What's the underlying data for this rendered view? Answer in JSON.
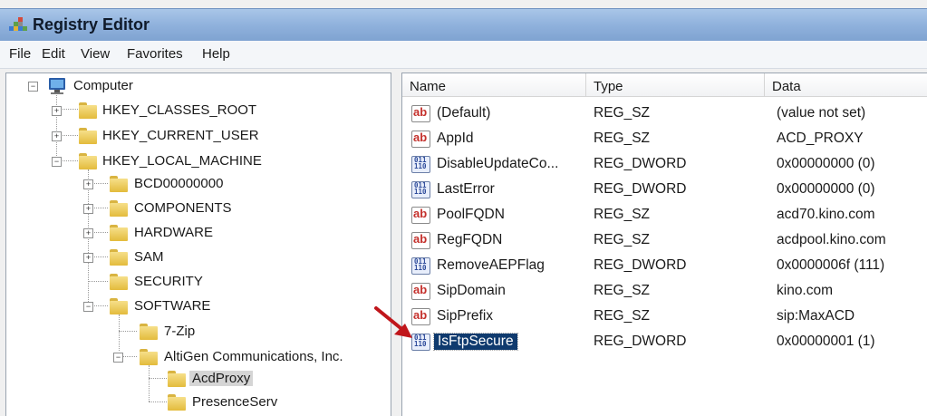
{
  "window": {
    "title": "Registry Editor"
  },
  "menu": [
    "File",
    "Edit",
    "View",
    "Favorites",
    "Help"
  ],
  "tree": {
    "root": "Computer",
    "hives": [
      "HKEY_CLASSES_ROOT",
      "HKEY_CURRENT_USER",
      "HKEY_LOCAL_MACHINE"
    ],
    "hklm_children": [
      "BCD00000000",
      "COMPONENTS",
      "HARDWARE",
      "SAM",
      "SECURITY",
      "SOFTWARE"
    ],
    "software_children": [
      "7-Zip",
      "AltiGen Communications, Inc."
    ],
    "altigen_children": [
      "AcdProxy",
      "PresenceServ"
    ],
    "selected": "AcdProxy"
  },
  "columns": {
    "name": "Name",
    "type": "Type",
    "data": "Data"
  },
  "values": [
    {
      "icon": "string-value-icon",
      "name": "(Default)",
      "type": "REG_SZ",
      "data": "(value not set)"
    },
    {
      "icon": "string-value-icon",
      "name": "AppId",
      "type": "REG_SZ",
      "data": "ACD_PROXY"
    },
    {
      "icon": "binary-value-icon",
      "name": "DisableUpdateCo...",
      "type": "REG_DWORD",
      "data": "0x00000000 (0)"
    },
    {
      "icon": "binary-value-icon",
      "name": "LastError",
      "type": "REG_DWORD",
      "data": "0x00000000 (0)"
    },
    {
      "icon": "string-value-icon",
      "name": "PoolFQDN",
      "type": "REG_SZ",
      "data": "acd70.kino.com"
    },
    {
      "icon": "string-value-icon",
      "name": "RegFQDN",
      "type": "REG_SZ",
      "data": "acdpool.kino.com"
    },
    {
      "icon": "binary-value-icon",
      "name": "RemoveAEPFlag",
      "type": "REG_DWORD",
      "data": "0x0000006f (111)"
    },
    {
      "icon": "string-value-icon",
      "name": "SipDomain",
      "type": "REG_SZ",
      "data": "kino.com"
    },
    {
      "icon": "string-value-icon",
      "name": "SipPrefix",
      "type": "REG_SZ",
      "data": "sip:MaxACD"
    },
    {
      "icon": "binary-value-icon",
      "name": "IsFtpSecure",
      "type": "REG_DWORD",
      "data": "0x00000001 (1)"
    }
  ],
  "selected_value": "IsFtpSecure",
  "icons": {
    "string": "ab",
    "binary_top": "011",
    "binary_bottom": "110"
  },
  "colors": {
    "selection": "#0f3a6e",
    "annotation_arrow": "#c0161b",
    "titlebar": "#8fb1dc"
  }
}
